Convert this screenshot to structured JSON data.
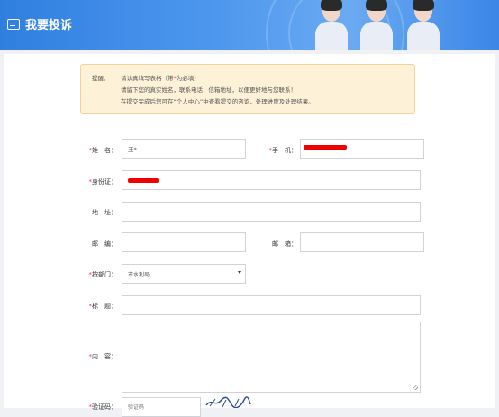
{
  "header": {
    "title": "我要投诉"
  },
  "notice": {
    "label": "提醒：",
    "line1_a": "请认真填写表格（带",
    "line1_star": "*",
    "line1_b": "为必填）",
    "line2": "请留下您的真实姓名，联系电话，信箱地址，以便更好地与您联系！",
    "line3": "在提交完成后您可在“个人中心”中查看提交的咨询，处理进度及处理结果。"
  },
  "form": {
    "name": {
      "label": "姓　名：",
      "value": "王*"
    },
    "phone": {
      "label": "手　机："
    },
    "id_card": {
      "label": "身份证："
    },
    "address": {
      "label": "地　址：",
      "value": ""
    },
    "postcode": {
      "label": "邮　编：",
      "value": ""
    },
    "email": {
      "label": "邮　箱：",
      "value": ""
    },
    "department": {
      "label": "按部门：",
      "selected": "市水利局"
    },
    "subject": {
      "label": "标　题：",
      "value": ""
    },
    "content": {
      "label": "内　容：",
      "value": ""
    },
    "captcha": {
      "label": "验证码：",
      "placeholder": "验证码"
    }
  },
  "colors": {
    "header": "#3b86e6",
    "required": "#e33",
    "notice_bg": "#fdf1d8",
    "redaction": "#e00"
  }
}
